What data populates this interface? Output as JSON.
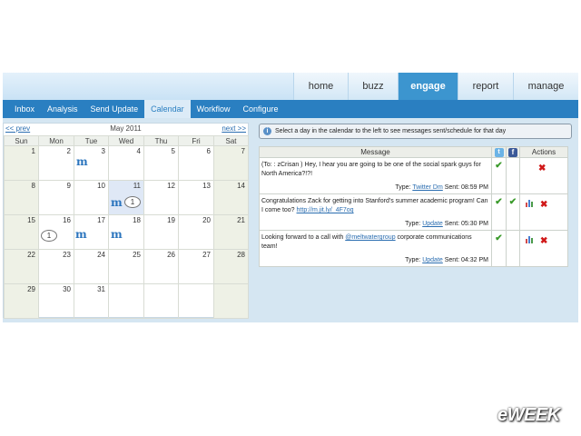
{
  "top_nav": [
    "home",
    "buzz",
    "engage",
    "report",
    "manage"
  ],
  "top_nav_active": "engage",
  "sub_nav": [
    "Inbox",
    "Analysis",
    "Send Update",
    "Calendar",
    "Workflow",
    "Configure"
  ],
  "sub_nav_active": "Calendar",
  "calendar": {
    "prev": "<< prev",
    "month": "May 2011",
    "next": "next >>",
    "weekdays": [
      "Sun",
      "Mon",
      "Tue",
      "Wed",
      "Thu",
      "Fri",
      "Sat"
    ],
    "weeks": [
      [
        "",
        "",
        "",
        "",
        "",
        "",
        ""
      ],
      [
        "1",
        "2",
        "3",
        "4",
        "5",
        "6",
        "7"
      ],
      [
        "8",
        "9",
        "10",
        "11",
        "12",
        "13",
        "14"
      ],
      [
        "15",
        "16",
        "17",
        "18",
        "19",
        "20",
        "21"
      ],
      [
        "22",
        "23",
        "24",
        "25",
        "26",
        "27",
        "28"
      ],
      [
        "29",
        "30",
        "31",
        "",
        "",
        "",
        ""
      ]
    ],
    "bubble_count": "1"
  },
  "notice": "Select a day in the calendar to the left to see messages sent/schedule for that day",
  "messages": {
    "headers": {
      "message": "Message",
      "actions": "Actions"
    },
    "rows": [
      {
        "text": "(To: : zCrisan ) Hey, I hear you are going to be one of the social spark guys for North America?!?!",
        "type_label": "Type:",
        "type_value": "Twitter Dm",
        "sent": "Sent: 08:59 PM",
        "twitter": true,
        "facebook": false
      },
      {
        "text": "Congratulations Zack for getting into Stanford's summer academic program! Can I come too?",
        "link": "http://m.jit.ly/_4F7oq",
        "type_label": "Type:",
        "type_value": "Update",
        "sent": "Sent: 05:30 PM",
        "twitter": true,
        "facebook": true
      },
      {
        "text_before": "Looking forward to a call with",
        "mention": "@meltwatergroup",
        "text_after": "corporate communications team!",
        "type_label": "Type:",
        "type_value": "Update",
        "sent": "Sent: 04:32 PM",
        "twitter": true,
        "facebook": false
      }
    ]
  },
  "watermark": "eWEEK",
  "colors": {
    "nav_active": "#3c95cf",
    "subnav": "#2a7fc1",
    "check": "#3a9a2a",
    "delete": "#d01818"
  }
}
